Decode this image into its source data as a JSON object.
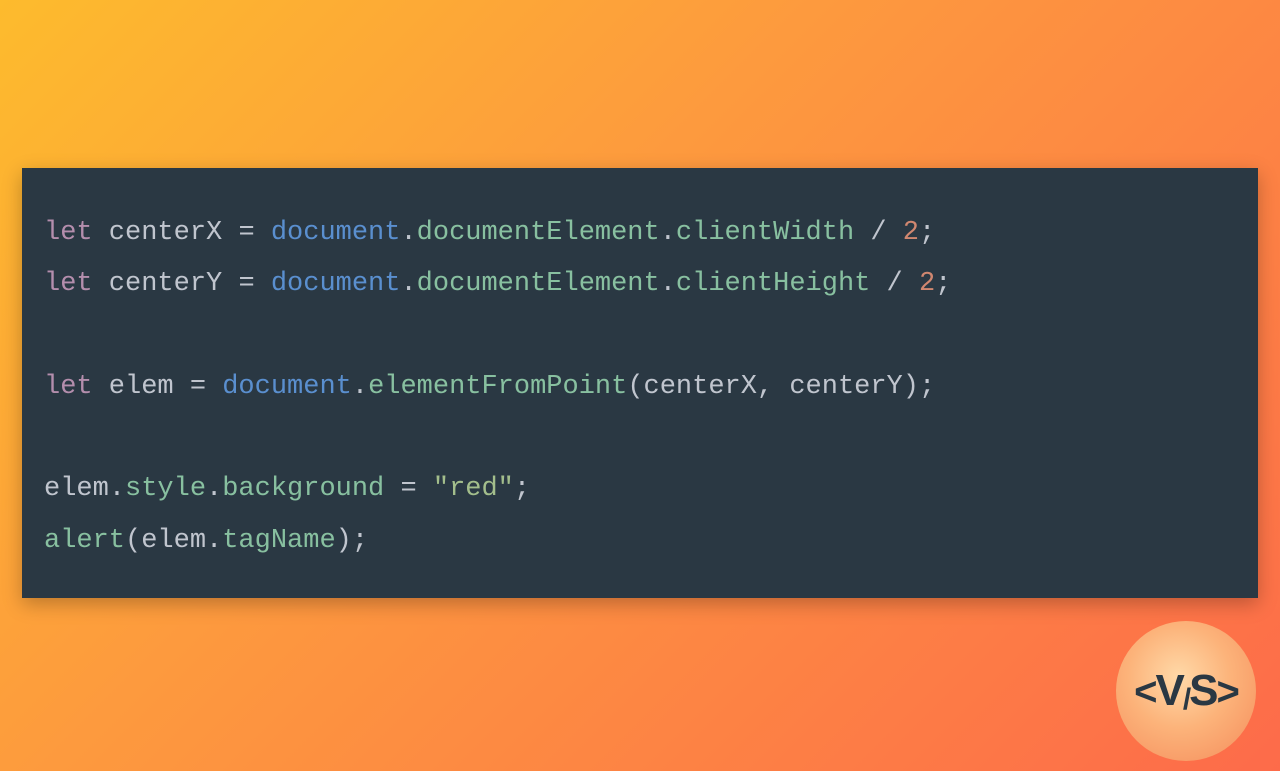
{
  "code": {
    "lines": [
      [
        {
          "cls": "kw",
          "t": "let"
        },
        {
          "cls": "id",
          "t": " centerX "
        },
        {
          "cls": "op",
          "t": "= "
        },
        {
          "cls": "obj",
          "t": "document"
        },
        {
          "cls": "dot",
          "t": "."
        },
        {
          "cls": "prop",
          "t": "documentElement"
        },
        {
          "cls": "dot",
          "t": "."
        },
        {
          "cls": "prop",
          "t": "clientWidth"
        },
        {
          "cls": "op",
          "t": " / "
        },
        {
          "cls": "num",
          "t": "2"
        },
        {
          "cls": "pun",
          "t": ";"
        }
      ],
      [
        {
          "cls": "kw",
          "t": "let"
        },
        {
          "cls": "id",
          "t": " centerY "
        },
        {
          "cls": "op",
          "t": "= "
        },
        {
          "cls": "obj",
          "t": "document"
        },
        {
          "cls": "dot",
          "t": "."
        },
        {
          "cls": "prop",
          "t": "documentElement"
        },
        {
          "cls": "dot",
          "t": "."
        },
        {
          "cls": "prop",
          "t": "clientHeight"
        },
        {
          "cls": "op",
          "t": " / "
        },
        {
          "cls": "num",
          "t": "2"
        },
        {
          "cls": "pun",
          "t": ";"
        }
      ],
      [],
      [
        {
          "cls": "kw",
          "t": "let"
        },
        {
          "cls": "id",
          "t": " elem "
        },
        {
          "cls": "op",
          "t": "= "
        },
        {
          "cls": "obj",
          "t": "document"
        },
        {
          "cls": "dot",
          "t": "."
        },
        {
          "cls": "fn",
          "t": "elementFromPoint"
        },
        {
          "cls": "pun",
          "t": "("
        },
        {
          "cls": "id",
          "t": "centerX"
        },
        {
          "cls": "pun",
          "t": ", "
        },
        {
          "cls": "id",
          "t": "centerY"
        },
        {
          "cls": "pun",
          "t": ");"
        }
      ],
      [],
      [
        {
          "cls": "id",
          "t": "elem"
        },
        {
          "cls": "dot",
          "t": "."
        },
        {
          "cls": "prop",
          "t": "style"
        },
        {
          "cls": "dot",
          "t": "."
        },
        {
          "cls": "prop",
          "t": "background"
        },
        {
          "cls": "op",
          "t": " = "
        },
        {
          "cls": "str",
          "t": "\"red\""
        },
        {
          "cls": "pun",
          "t": ";"
        }
      ],
      [
        {
          "cls": "fn",
          "t": "alert"
        },
        {
          "cls": "pun",
          "t": "("
        },
        {
          "cls": "id",
          "t": "elem"
        },
        {
          "cls": "dot",
          "t": "."
        },
        {
          "cls": "prop",
          "t": "tagName"
        },
        {
          "cls": "pun",
          "t": ");"
        }
      ]
    ]
  },
  "logo": {
    "lt": "<",
    "v": "V",
    "sl": "/",
    "s": "S",
    "gt": ">"
  }
}
